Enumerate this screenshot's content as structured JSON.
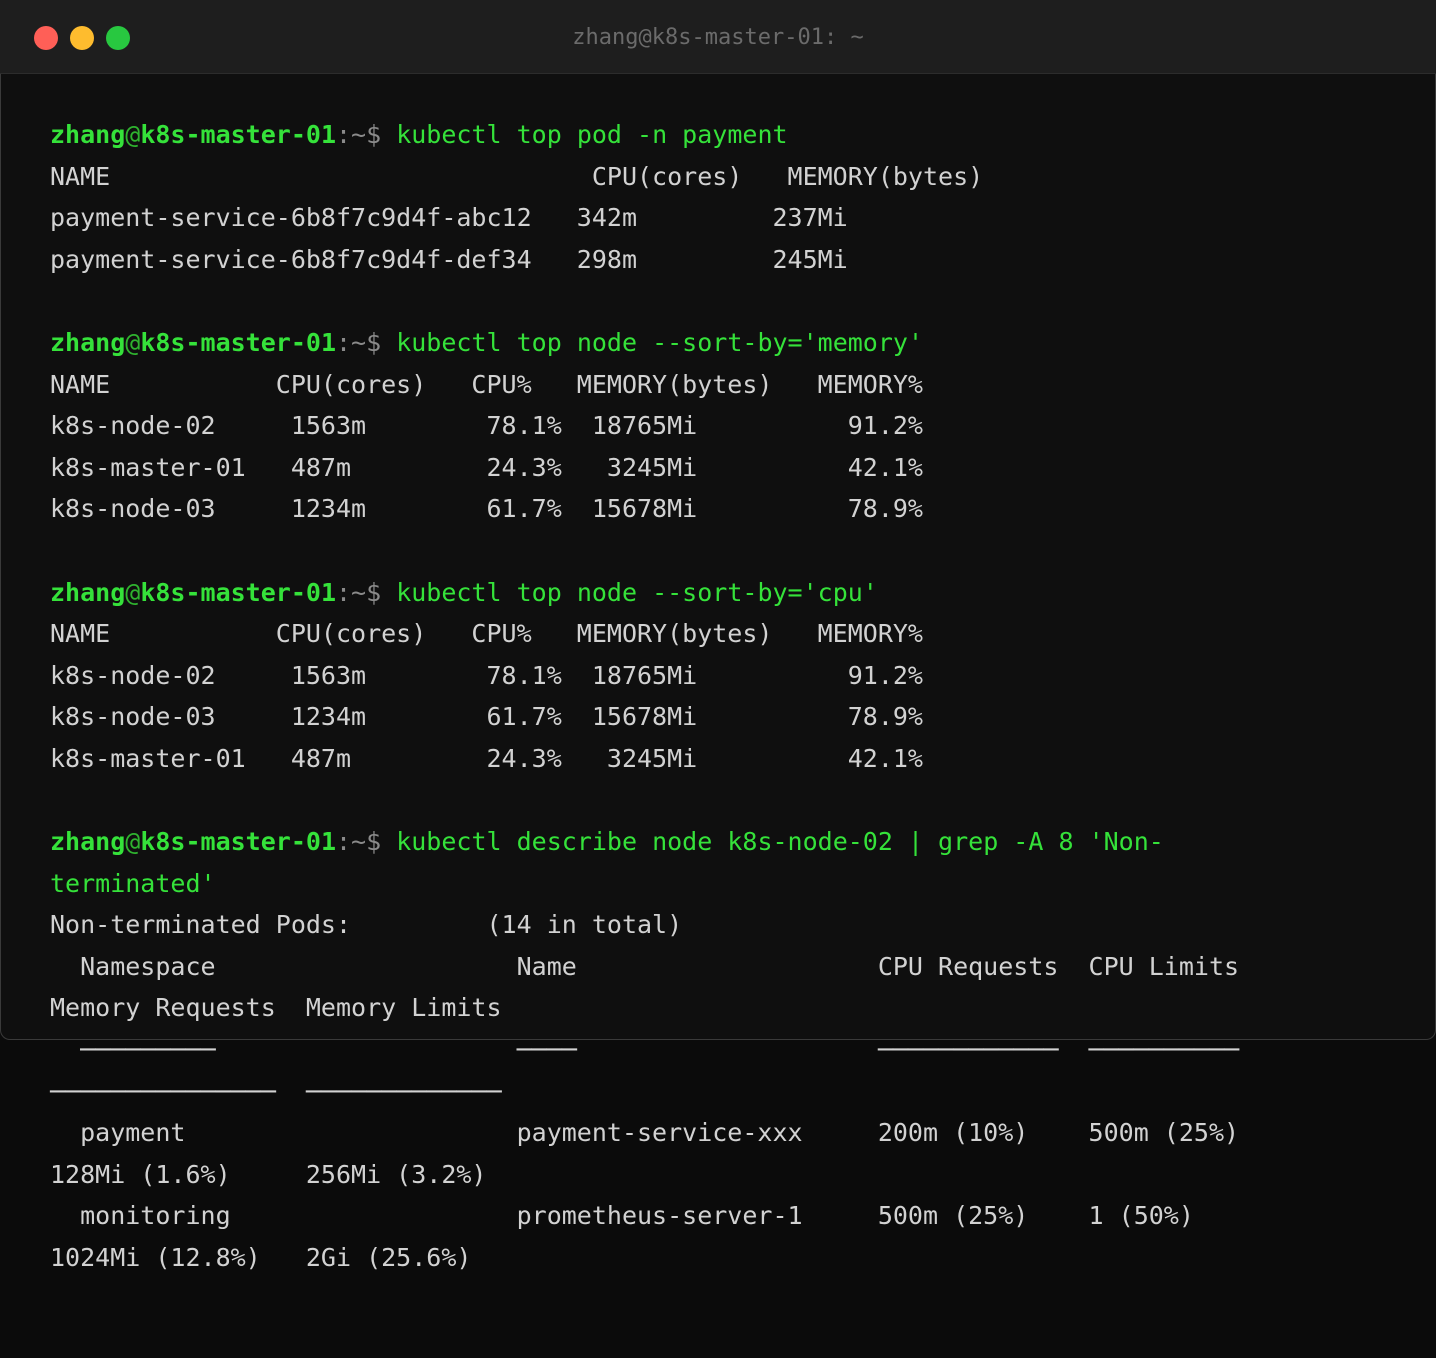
{
  "window": {
    "title": "zhang@k8s-master-01: ~",
    "colors": {
      "close": "#ff5f57",
      "minimize": "#febc2e",
      "maximize": "#28c840",
      "prompt": "#35e23a",
      "text": "#d2d2d2"
    }
  },
  "prompt": {
    "user": "zhang",
    "at": "@",
    "host": "k8s-master-01",
    "path": ":~$"
  },
  "lines": [
    {
      "type": "prompt",
      "cmd": " kubectl top pod -n payment"
    },
    {
      "type": "out",
      "text": "NAME                                CPU(cores)   MEMORY(bytes)"
    },
    {
      "type": "out",
      "text": "payment-service-6b8f7c9d4f-abc12   342m         237Mi"
    },
    {
      "type": "out",
      "text": "payment-service-6b8f7c9d4f-def34   298m         245Mi"
    },
    {
      "type": "blank",
      "text": ""
    },
    {
      "type": "prompt",
      "cmd": " kubectl top node --sort-by='memory'"
    },
    {
      "type": "out",
      "text": "NAME           CPU(cores)   CPU%   MEMORY(bytes)   MEMORY%"
    },
    {
      "type": "out",
      "text": "k8s-node-02     1563m        78.1%  18765Mi          91.2%"
    },
    {
      "type": "out",
      "text": "k8s-master-01   487m         24.3%   3245Mi          42.1%"
    },
    {
      "type": "out",
      "text": "k8s-node-03     1234m        61.7%  15678Mi          78.9%"
    },
    {
      "type": "blank",
      "text": ""
    },
    {
      "type": "prompt",
      "cmd": " kubectl top node --sort-by='cpu'"
    },
    {
      "type": "out",
      "text": "NAME           CPU(cores)   CPU%   MEMORY(bytes)   MEMORY%"
    },
    {
      "type": "out",
      "text": "k8s-node-02     1563m        78.1%  18765Mi          91.2%"
    },
    {
      "type": "out",
      "text": "k8s-node-03     1234m        61.7%  15678Mi          78.9%"
    },
    {
      "type": "out",
      "text": "k8s-master-01   487m         24.3%   3245Mi          42.1%"
    },
    {
      "type": "blank",
      "text": ""
    },
    {
      "type": "prompt",
      "cmd": " kubectl describe node k8s-node-02 | grep -A 8 'Non-"
    },
    {
      "type": "cmdcont",
      "text": "terminated'"
    },
    {
      "type": "out",
      "text": "Non-terminated Pods:         (14 in total)"
    },
    {
      "type": "out",
      "text": "  Namespace                    Name                    CPU Requests  CPU Limits"
    },
    {
      "type": "out",
      "text": "Memory Requests  Memory Limits"
    },
    {
      "type": "out",
      "text": "  ─────────                    ────                    ────────────  ──────────"
    },
    {
      "type": "out",
      "text": "───────────────  ─────────────"
    },
    {
      "type": "out",
      "text": "  payment                      payment-service-xxx     200m (10%)    500m (25%)"
    },
    {
      "type": "out",
      "text": "128Mi (1.6%)     256Mi (3.2%)"
    },
    {
      "type": "out",
      "text": "  monitoring                   prometheus-server-1     500m (25%)    1 (50%)"
    },
    {
      "type": "out",
      "text": "1024Mi (12.8%)   2Gi (25.6%)"
    }
  ]
}
